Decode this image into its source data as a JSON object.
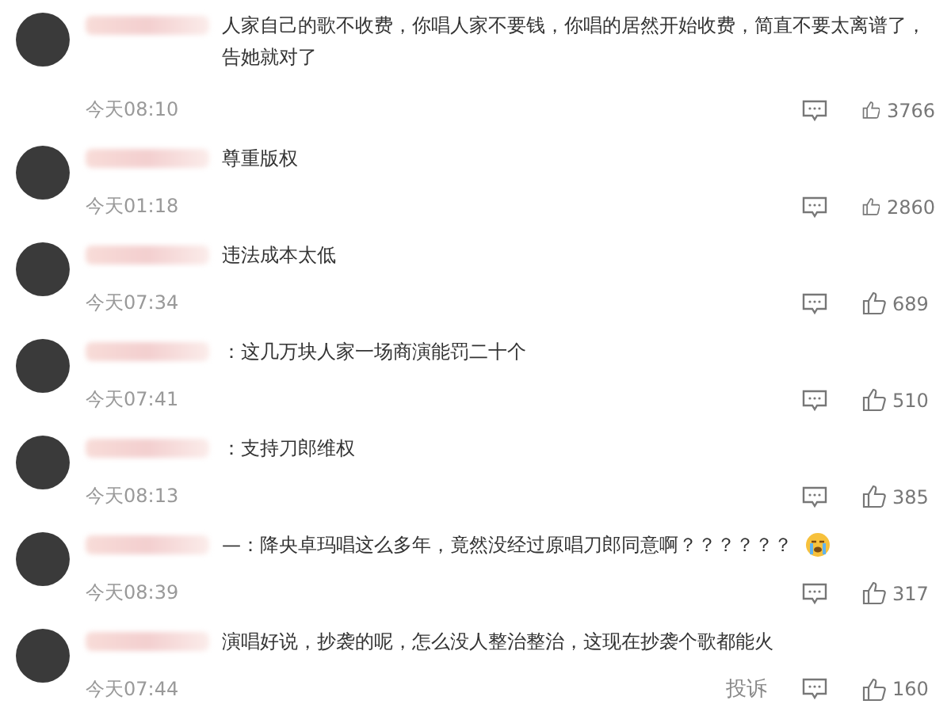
{
  "comments": [
    {
      "text": "人家自己的歌不收费，你唱人家不要钱，你唱的居然开始收费，简直不要太离谱了，告她就对了",
      "emoji": false,
      "time": "今天08:10",
      "likes": "3766"
    },
    {
      "text": "尊重版权",
      "emoji": false,
      "time": "今天01:18",
      "likes": "2860"
    },
    {
      "text": "违法成本太低",
      "emoji": false,
      "time": "今天07:34",
      "likes": "689"
    },
    {
      "text": "：这几万块人家一场商演能罚二十个",
      "emoji": false,
      "time": "今天07:41",
      "likes": "510"
    },
    {
      "text": "：支持刀郎维权",
      "emoji": false,
      "time": "今天08:13",
      "likes": "385"
    },
    {
      "text": "—：降央卓玛唱这么多年，竟然没经过原唱刀郎同意啊？？？？？？",
      "emoji": true,
      "time": "今天08:39",
      "likes": "317"
    },
    {
      "text": "演唱好说，抄袭的呢，怎么没人整治整治，这现在抄袭个歌都能火",
      "emoji": false,
      "time": "今天07:44",
      "likes": "160",
      "report": "投诉"
    }
  ]
}
